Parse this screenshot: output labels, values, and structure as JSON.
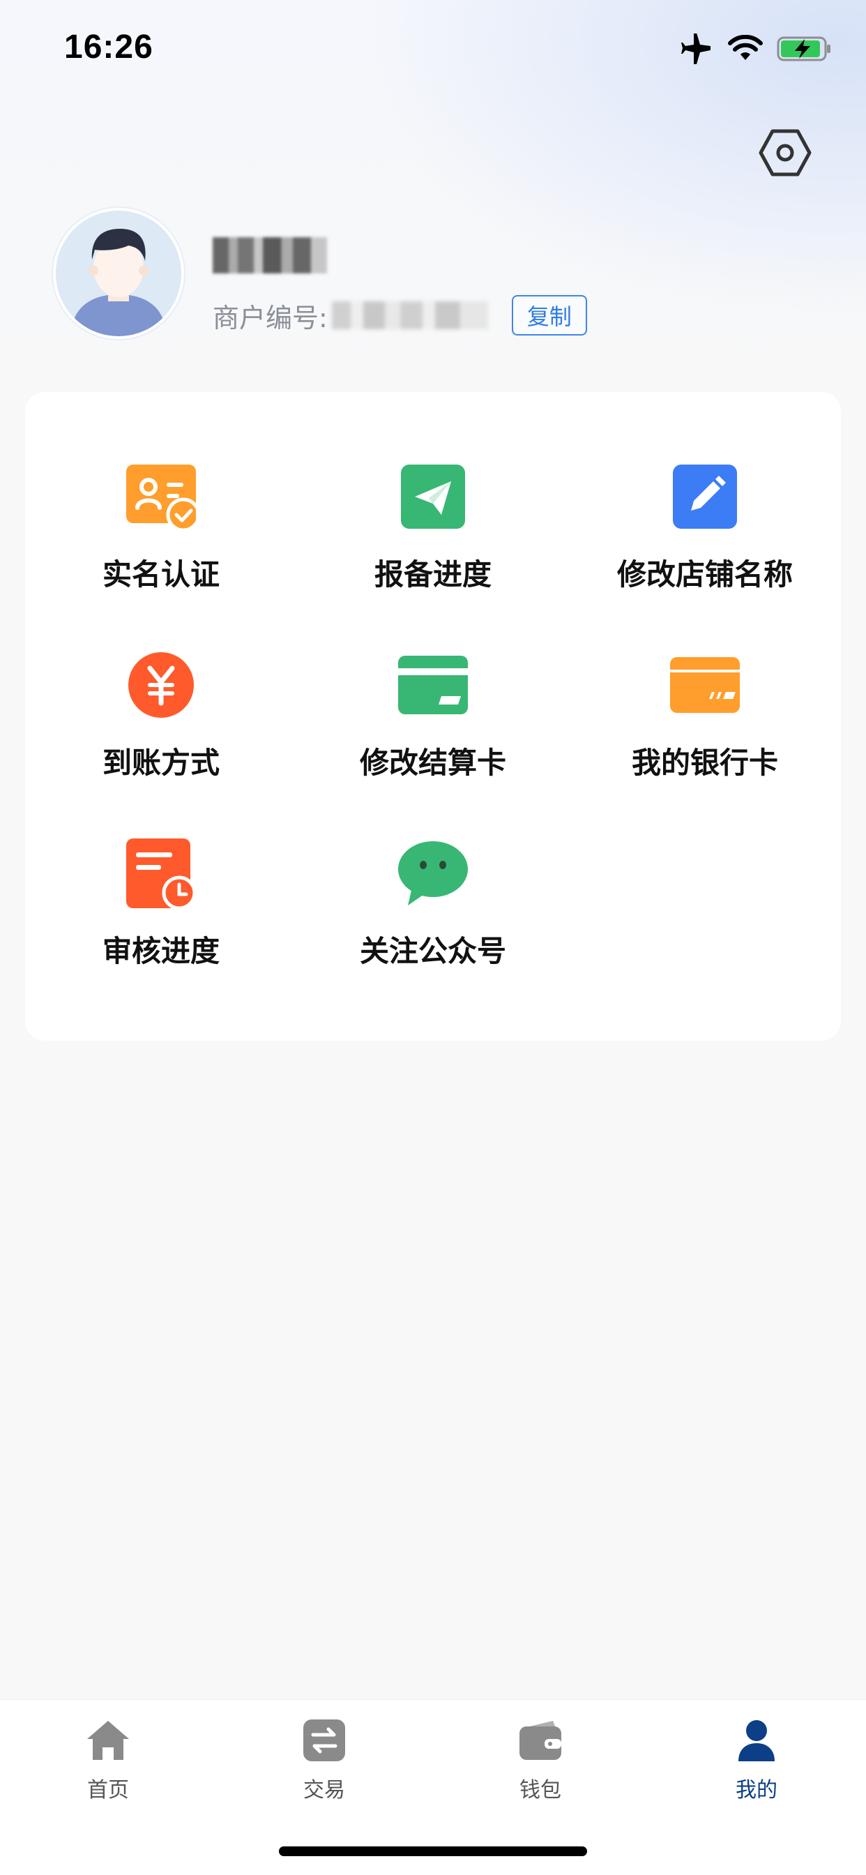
{
  "status_bar": {
    "time": "16:26"
  },
  "profile": {
    "merchant_label": "商户编号:",
    "copy_label": "复制"
  },
  "menu": {
    "items": [
      {
        "label": "实名认证",
        "icon": "id-card-check-icon",
        "color": "#FF9E2C"
      },
      {
        "label": "报备进度",
        "icon": "paper-plane-icon",
        "color": "#38B774"
      },
      {
        "label": "修改店铺名称",
        "icon": "edit-pencil-icon",
        "color": "#3C7CF5"
      },
      {
        "label": "到账方式",
        "icon": "yuan-coin-icon",
        "color": "#FF5A2C"
      },
      {
        "label": "修改结算卡",
        "icon": "card-icon",
        "color": "#38B774"
      },
      {
        "label": "我的银行卡",
        "icon": "bank-card-icon",
        "color": "#FF9E2C"
      },
      {
        "label": "审核进度",
        "icon": "document-clock-icon",
        "color": "#FF5A2C"
      },
      {
        "label": "关注公众号",
        "icon": "wechat-icon",
        "color": "#38B774"
      }
    ]
  },
  "tabbar": {
    "tabs": [
      {
        "label": "首页",
        "icon": "home-icon"
      },
      {
        "label": "交易",
        "icon": "exchange-icon"
      },
      {
        "label": "钱包",
        "icon": "wallet-icon"
      },
      {
        "label": "我的",
        "icon": "user-icon"
      }
    ],
    "active_index": 3,
    "active_color": "#0C3F87",
    "inactive_color": "#555555"
  }
}
